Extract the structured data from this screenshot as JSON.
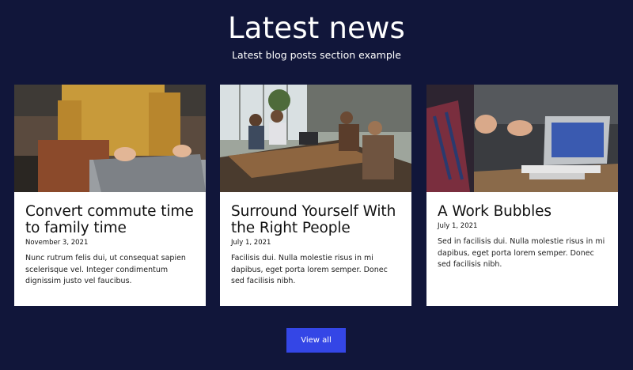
{
  "section": {
    "title": "Latest news",
    "subtitle": "Latest blog posts section example"
  },
  "posts": [
    {
      "image_icon": "photo-laptop-typing",
      "title": "Convert commute time to family time",
      "date": "November 3, 2021",
      "excerpt": "Nunc rutrum felis dui, ut consequat sapien scelerisque vel. Integer condimentum dignissim justo vel faucibus."
    },
    {
      "image_icon": "photo-team-meeting",
      "title": "Surround Yourself With the Right People",
      "date": "July 1, 2021",
      "excerpt": "Facilisis dui. Nulla molestie risus in mi dapibus, eget porta lorem semper. Donec sed facilisis nibh."
    },
    {
      "image_icon": "photo-work-discussion",
      "title": "A Work Bubbles",
      "date": "July 1, 2021",
      "excerpt": "Sed in facilisis dui. Nulla molestie risus in mi dapibus, eget porta lorem semper. Donec sed facilisis nibh."
    }
  ],
  "actions": {
    "view_all_label": "View all"
  },
  "colors": {
    "background": "#11163a",
    "card": "#ffffff",
    "accent": "#3446e6"
  }
}
